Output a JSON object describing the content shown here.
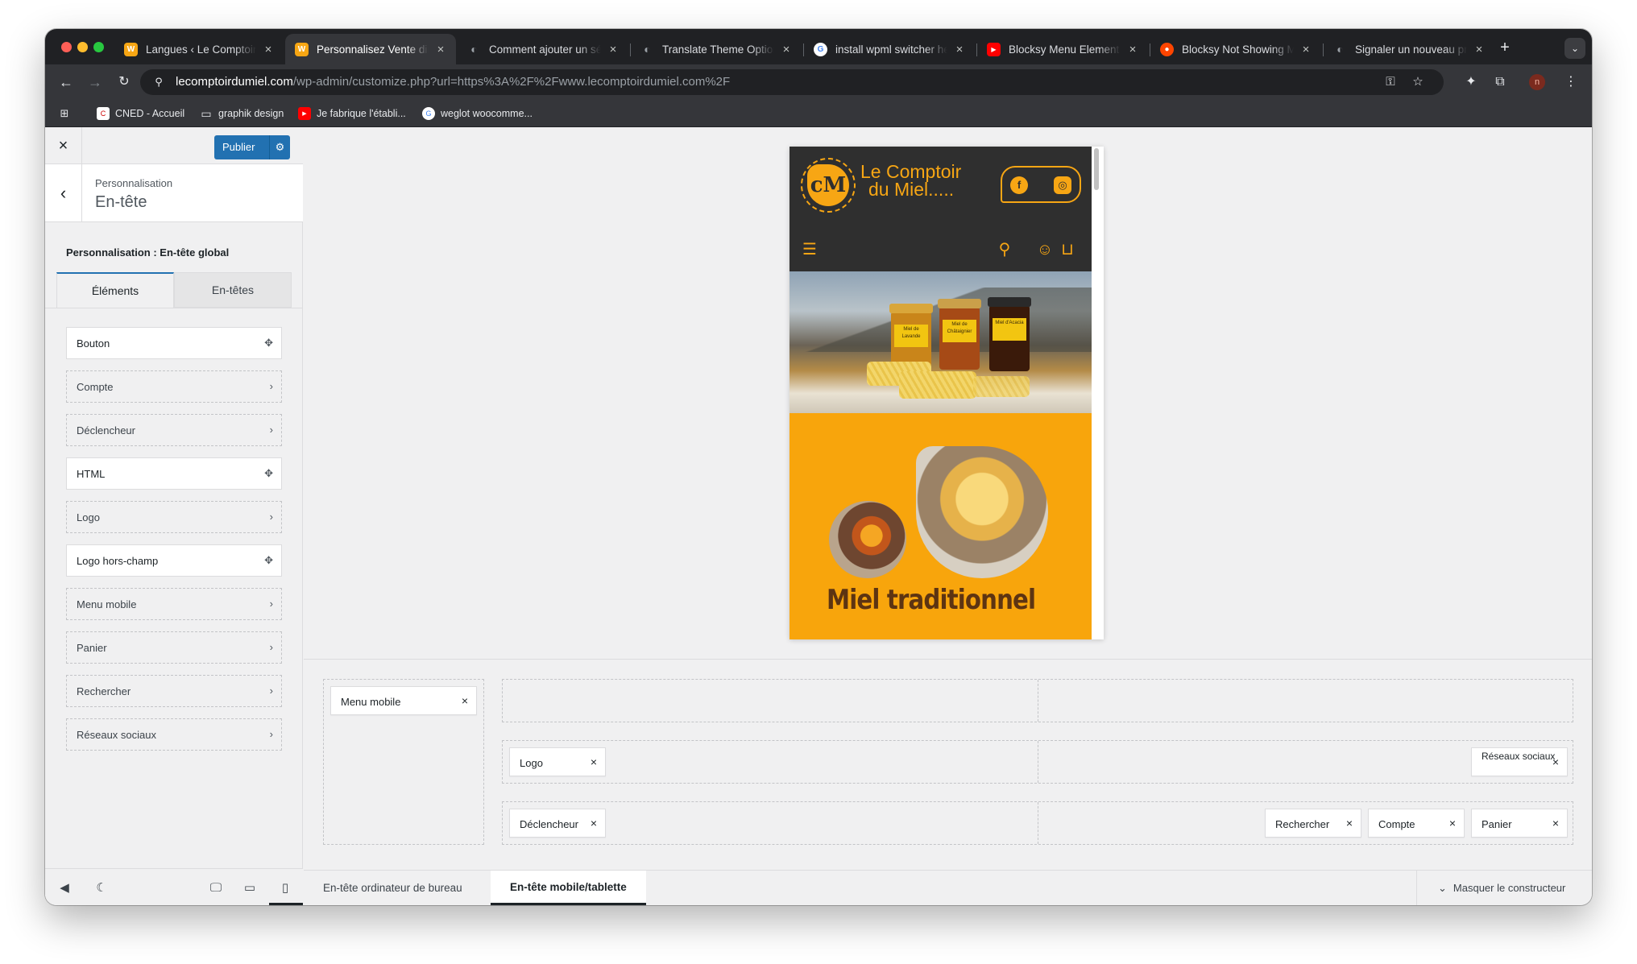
{
  "browser": {
    "tabs": [
      {
        "title": "Langues ‹ Le Comptoir du Miel",
        "favicon_color": "#f7a614",
        "favicon_glyph": "wp"
      },
      {
        "title": "Personnalisez Vente directe",
        "favicon_color": "#f7a614",
        "favicon_glyph": "wp"
      },
      {
        "title": "Comment ajouter un sélecteur",
        "favicon_color": "#5f6368",
        "favicon_glyph": "◐"
      },
      {
        "title": "Translate Theme Options",
        "favicon_color": "#5f6368",
        "favicon_glyph": "◐"
      },
      {
        "title": "install wpml switcher header",
        "favicon_color": "#ffffff",
        "favicon_glyph": "G"
      },
      {
        "title": "Blocksy Menu Element | Blocksy",
        "favicon_color": "#ff0000",
        "favicon_glyph": "▶"
      },
      {
        "title": "Blocksy Not Showing Menu",
        "favicon_color": "#ff4500",
        "favicon_glyph": "●"
      },
      {
        "title": "Signaler un nouveau problème",
        "favicon_color": "#5f6368",
        "favicon_glyph": "◐"
      }
    ],
    "url_host": "lecomptoirdumiel.com",
    "url_path": "/wp-admin/customize.php?url=https%3A%2F%2Fwww.lecomptoirdumiel.com%2F",
    "profile_initial": "n",
    "bookmarks": [
      {
        "label": "CNED - Accueil",
        "icon": "cned-icon"
      },
      {
        "label": "graphik design",
        "icon": "folder-icon"
      },
      {
        "label": "Je fabrique l'établi...",
        "icon": "youtube-icon"
      },
      {
        "label": "weglot woocomme...",
        "icon": "google-icon"
      }
    ]
  },
  "customizer": {
    "publish_label": "Publier",
    "breadcrumb": "Personnalisation",
    "panel_title": "En-tête",
    "section_title": "Personnalisation : En-tête global",
    "tabs": [
      "Éléments",
      "En-têtes"
    ],
    "elements": [
      {
        "label": "Bouton",
        "style": "solid",
        "icon": "move-icon"
      },
      {
        "label": "Compte",
        "style": "dashed",
        "icon": "chevron-right-icon"
      },
      {
        "label": "Déclencheur",
        "style": "dashed",
        "icon": "chevron-right-icon"
      },
      {
        "label": "HTML",
        "style": "solid",
        "icon": "move-icon"
      },
      {
        "label": "Logo",
        "style": "dashed",
        "icon": "chevron-right-icon"
      },
      {
        "label": "Logo hors-champ",
        "style": "solid",
        "icon": "move-icon"
      },
      {
        "label": "Menu mobile",
        "style": "dashed",
        "icon": "chevron-right-icon"
      },
      {
        "label": "Panier",
        "style": "dashed",
        "icon": "chevron-right-icon"
      },
      {
        "label": "Rechercher",
        "style": "dashed",
        "icon": "chevron-right-icon"
      },
      {
        "label": "Réseaux sociaux",
        "style": "dashed",
        "icon": "chevron-right-icon"
      }
    ]
  },
  "preview": {
    "logo_line1": "Le Comptoir",
    "logo_line2": "du Miel.....",
    "logo_mark": "cM",
    "banner_title": "Miel traditionnel",
    "jar_labels": [
      "Miel de Lavande",
      "Miel de Châtaignier",
      "Miel d'Acacia"
    ],
    "brand_color": "#f7a614"
  },
  "builder": {
    "offcanvas_chip": "Menu mobile",
    "row_middle": {
      "left": "Logo",
      "right": "Réseaux sociaux"
    },
    "row_bottom": {
      "left": "Déclencheur",
      "right": [
        "Rechercher",
        "Compte",
        "Panier"
      ]
    }
  },
  "device_tabs": [
    "En-tête ordinateur de bureau",
    "En-tête mobile/tablette"
  ],
  "hide_builder_label": "Masquer le constructeur"
}
